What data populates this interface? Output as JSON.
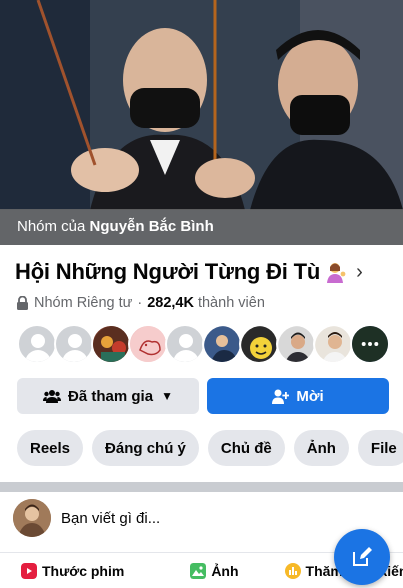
{
  "cover": {
    "caption_prefix": "Nhóm của",
    "owner_name": "Nguyễn Bắc Bình"
  },
  "group": {
    "title": "Hội Những Người Từng Đi Tù",
    "title_emoji": "woman-tipping-hand-icon",
    "privacy": "Nhóm Riêng tư",
    "separator": "·",
    "members_count": "282,4K",
    "members_label": "thành viên"
  },
  "buttons": {
    "joined_label": "Đã tham gia",
    "invite_label": "Mời"
  },
  "tabs": [
    {
      "label": "Reels"
    },
    {
      "label": "Đáng chú ý"
    },
    {
      "label": "Chủ đề"
    },
    {
      "label": "Ảnh"
    },
    {
      "label": "File"
    }
  ],
  "composer": {
    "placeholder": "Bạn viết gì đi..."
  },
  "post_actions": [
    {
      "label": "Thước phim",
      "icon": "reel-icon",
      "color": "#e41e3f"
    },
    {
      "label": "Ảnh",
      "icon": "photo-icon",
      "color": "#45bd62"
    },
    {
      "label": "Thăm dò ý kiến",
      "icon": "poll-icon",
      "color": "#f7b928"
    }
  ],
  "colors": {
    "accent": "#1b74e4",
    "chip_bg": "#e4e6eb",
    "secondary_text": "#65676b"
  }
}
